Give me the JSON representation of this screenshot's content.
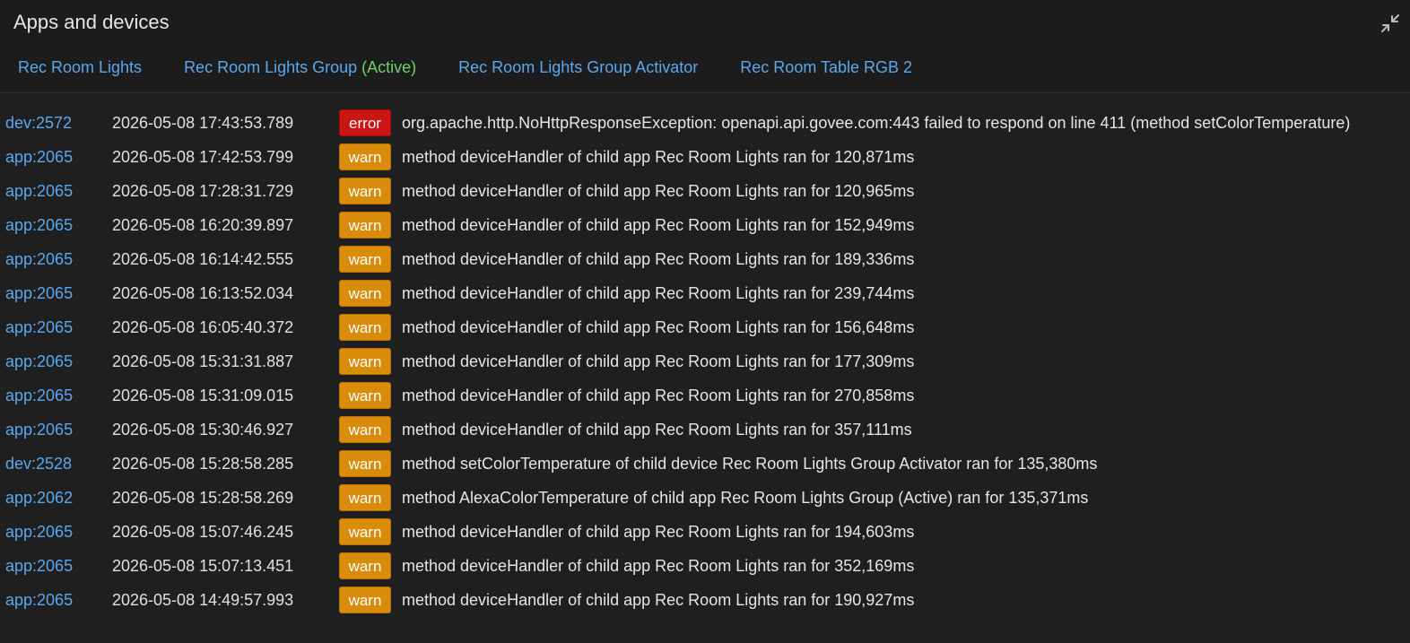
{
  "panel": {
    "title": "Apps and devices",
    "tabs": [
      {
        "label": "Rec Room Lights",
        "tag": ""
      },
      {
        "label": "Rec Room Lights Group ",
        "tag": "(Active)"
      },
      {
        "label": "Rec Room Lights Group Activator",
        "tag": ""
      },
      {
        "label": "Rec Room Table RGB 2",
        "tag": ""
      }
    ]
  },
  "colors": {
    "link": "#5aa8ee",
    "active": "#6bd46b",
    "warn": "#d98b0c",
    "error": "#cc1414",
    "background": "#1f1f1f"
  },
  "logs": [
    {
      "source": "dev:2572",
      "time": "2026-05-08 17:43:53.789",
      "level": "error",
      "message": "org.apache.http.NoHttpResponseException: openapi.api.govee.com:443 failed to respond on line 411 (method setColorTemperature)"
    },
    {
      "source": "app:2065",
      "time": "2026-05-08 17:42:53.799",
      "level": "warn",
      "message": "method deviceHandler of child app Rec Room Lights ran for 120,871ms"
    },
    {
      "source": "app:2065",
      "time": "2026-05-08 17:28:31.729",
      "level": "warn",
      "message": "method deviceHandler of child app Rec Room Lights ran for 120,965ms"
    },
    {
      "source": "app:2065",
      "time": "2026-05-08 16:20:39.897",
      "level": "warn",
      "message": "method deviceHandler of child app Rec Room Lights ran for 152,949ms"
    },
    {
      "source": "app:2065",
      "time": "2026-05-08 16:14:42.555",
      "level": "warn",
      "message": "method deviceHandler of child app Rec Room Lights ran for 189,336ms"
    },
    {
      "source": "app:2065",
      "time": "2026-05-08 16:13:52.034",
      "level": "warn",
      "message": "method deviceHandler of child app Rec Room Lights ran for 239,744ms"
    },
    {
      "source": "app:2065",
      "time": "2026-05-08 16:05:40.372",
      "level": "warn",
      "message": "method deviceHandler of child app Rec Room Lights ran for 156,648ms"
    },
    {
      "source": "app:2065",
      "time": "2026-05-08 15:31:31.887",
      "level": "warn",
      "message": "method deviceHandler of child app Rec Room Lights ran for 177,309ms"
    },
    {
      "source": "app:2065",
      "time": "2026-05-08 15:31:09.015",
      "level": "warn",
      "message": "method deviceHandler of child app Rec Room Lights ran for 270,858ms"
    },
    {
      "source": "app:2065",
      "time": "2026-05-08 15:30:46.927",
      "level": "warn",
      "message": "method deviceHandler of child app Rec Room Lights ran for 357,111ms"
    },
    {
      "source": "dev:2528",
      "time": "2026-05-08 15:28:58.285",
      "level": "warn",
      "message": "method setColorTemperature of child device Rec Room Lights Group Activator ran for 135,380ms"
    },
    {
      "source": "app:2062",
      "time": "2026-05-08 15:28:58.269",
      "level": "warn",
      "message": "method AlexaColorTemperature of child app Rec Room Lights Group (Active) ran for 135,371ms"
    },
    {
      "source": "app:2065",
      "time": "2026-05-08 15:07:46.245",
      "level": "warn",
      "message": "method deviceHandler of child app Rec Room Lights ran for 194,603ms"
    },
    {
      "source": "app:2065",
      "time": "2026-05-08 15:07:13.451",
      "level": "warn",
      "message": "method deviceHandler of child app Rec Room Lights ran for 352,169ms"
    },
    {
      "source": "app:2065",
      "time": "2026-05-08 14:49:57.993",
      "level": "warn",
      "message": "method deviceHandler of child app Rec Room Lights ran for 190,927ms"
    }
  ]
}
